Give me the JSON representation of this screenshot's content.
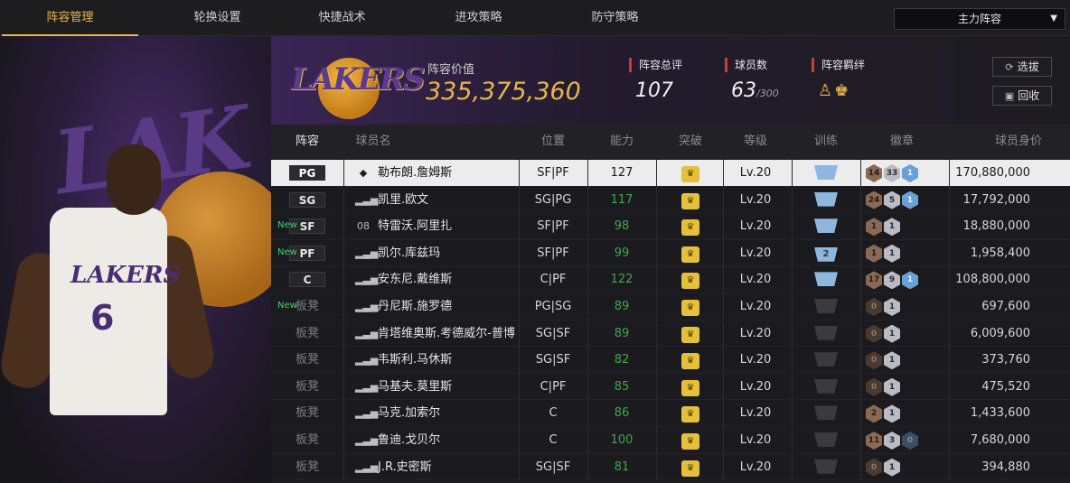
{
  "nav": {
    "tabs": [
      "阵容管理",
      "轮换设置",
      "快捷战术",
      "进攻策略",
      "防守策略"
    ],
    "active_index": 0,
    "dropdown": {
      "selected": "主力阵容"
    }
  },
  "team": {
    "logo_text": "LAKERS",
    "value_label": "阵容价值",
    "value": "335,375,360",
    "overall_label": "阵容总评",
    "overall": "107",
    "players_label": "球员数",
    "players_count": "63",
    "players_max": "/300",
    "bond_label": "阵容羁绊",
    "btn_select": "选拔",
    "btn_recycle": "回收"
  },
  "hero": {
    "player_number": "6",
    "jersey_text": "LAKERS"
  },
  "table": {
    "headers": [
      "阵容",
      "球员名",
      "位置",
      "能力",
      "突破",
      "等级",
      "训练",
      "徽章",
      "球员身价"
    ],
    "rows": [
      {
        "slot": "PG",
        "bench": false,
        "new": "",
        "sig": "◆",
        "name": "勒布朗.詹姆斯",
        "pos": "SF|PF",
        "ability": "127",
        "ab_color": "white",
        "level": "Lv.20",
        "train": "",
        "train_style": "lit",
        "badges": [
          [
            "bronze",
            "14"
          ],
          [
            "silver",
            "33"
          ],
          [
            "gold",
            "1"
          ]
        ],
        "price": "170,880,000",
        "selected": true
      },
      {
        "slot": "SG",
        "bench": false,
        "new": "",
        "sig": "▂▃▅",
        "name": "凯里.欧文",
        "pos": "SG|PG",
        "ability": "117",
        "ab_color": "green",
        "level": "Lv.20",
        "train": "",
        "train_style": "lit",
        "badges": [
          [
            "bronze",
            "24"
          ],
          [
            "silver",
            "5"
          ],
          [
            "gold",
            "1"
          ]
        ],
        "price": "17,792,000",
        "selected": false
      },
      {
        "slot": "SF",
        "bench": false,
        "new": "New",
        "sig": "08",
        "name": "特雷沃.阿里扎",
        "pos": "SF|PF",
        "ability": "98",
        "ab_color": "green",
        "level": "Lv.20",
        "train": "",
        "train_style": "lit",
        "badges": [
          [
            "bronze",
            "1"
          ],
          [
            "silver",
            "1"
          ]
        ],
        "price": "18,880,000",
        "selected": false
      },
      {
        "slot": "PF",
        "bench": false,
        "new": "New",
        "sig": "▂▃▅",
        "name": "凯尔.库兹玛",
        "pos": "SF|PF",
        "ability": "99",
        "ab_color": "green",
        "level": "Lv.20",
        "train": "2",
        "train_style": "lit",
        "badges": [
          [
            "bronze",
            "1"
          ],
          [
            "silver",
            "1"
          ]
        ],
        "price": "1,958,400",
        "selected": false
      },
      {
        "slot": "C",
        "bench": false,
        "new": "",
        "sig": "▂▃▅",
        "name": "安东尼.戴维斯",
        "pos": "C|PF",
        "ability": "122",
        "ab_color": "green",
        "level": "Lv.20",
        "train": "",
        "train_style": "lit",
        "badges": [
          [
            "bronze",
            "17"
          ],
          [
            "silver",
            "9"
          ],
          [
            "gold",
            "1"
          ]
        ],
        "price": "108,800,000",
        "selected": false
      },
      {
        "slot": "板凳",
        "bench": true,
        "new": "New",
        "sig": "▂▃▅",
        "name": "丹尼斯.施罗德",
        "pos": "PG|SG",
        "ability": "89",
        "ab_color": "green",
        "level": "Lv.20",
        "train": "",
        "train_style": "dim",
        "badges": [
          [
            "dark",
            "0"
          ],
          [
            "silver",
            "1"
          ]
        ],
        "price": "697,600",
        "selected": false
      },
      {
        "slot": "板凳",
        "bench": true,
        "new": "",
        "sig": "▂▃▅",
        "name": "肯塔维奥斯.考德威尔-普博",
        "pos": "SG|SF",
        "ability": "89",
        "ab_color": "green",
        "level": "Lv.20",
        "train": "",
        "train_style": "dim",
        "badges": [
          [
            "dark",
            "0"
          ],
          [
            "silver",
            "1"
          ]
        ],
        "price": "6,009,600",
        "selected": false
      },
      {
        "slot": "板凳",
        "bench": true,
        "new": "",
        "sig": "▂▃▅",
        "name": "韦斯利.马休斯",
        "pos": "SG|SF",
        "ability": "82",
        "ab_color": "green",
        "level": "Lv.20",
        "train": "",
        "train_style": "dim",
        "badges": [
          [
            "dark",
            "0"
          ],
          [
            "silver",
            "1"
          ]
        ],
        "price": "373,760",
        "selected": false
      },
      {
        "slot": "板凳",
        "bench": true,
        "new": "",
        "sig": "▂▃▅",
        "name": "马基夫.莫里斯",
        "pos": "C|PF",
        "ability": "85",
        "ab_color": "green",
        "level": "Lv.20",
        "train": "",
        "train_style": "dim",
        "badges": [
          [
            "dark",
            "0"
          ],
          [
            "silver",
            "1"
          ]
        ],
        "price": "475,520",
        "selected": false
      },
      {
        "slot": "板凳",
        "bench": true,
        "new": "",
        "sig": "▂▃▅",
        "name": "马克.加索尔",
        "pos": "C",
        "ability": "86",
        "ab_color": "green",
        "level": "Lv.20",
        "train": "",
        "train_style": "dim",
        "badges": [
          [
            "bronze",
            "2"
          ],
          [
            "silver",
            "1"
          ]
        ],
        "price": "1,433,600",
        "selected": false
      },
      {
        "slot": "板凳",
        "bench": true,
        "new": "",
        "sig": "▂▃▅",
        "name": "鲁迪.戈贝尔",
        "pos": "C",
        "ability": "100",
        "ab_color": "green",
        "level": "Lv.20",
        "train": "",
        "train_style": "dim",
        "badges": [
          [
            "bronze",
            "11"
          ],
          [
            "silver",
            "3"
          ],
          [
            "darkblue",
            "0"
          ]
        ],
        "price": "7,680,000",
        "selected": false
      },
      {
        "slot": "板凳",
        "bench": true,
        "new": "",
        "sig": "▂▃▅",
        "name": "J.R.史密斯",
        "pos": "SG|SF",
        "ability": "81",
        "ab_color": "green",
        "level": "Lv.20",
        "train": "",
        "train_style": "dim",
        "badges": [
          [
            "dark",
            "0"
          ],
          [
            "silver",
            "1"
          ]
        ],
        "price": "394,880",
        "selected": false
      }
    ]
  },
  "colors": {
    "accent": "#e8b64a",
    "green": "#3ea84a",
    "new": "#3fd46a",
    "stat_marker": "#d23a3a"
  }
}
